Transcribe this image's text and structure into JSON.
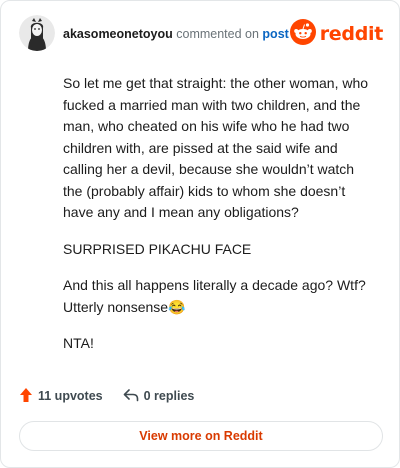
{
  "header": {
    "username": "akasomeonetoyou",
    "action": "commented on",
    "post_link": "post",
    "brand": "reddit"
  },
  "comment": {
    "paragraphs": [
      "So let me get that straight: the other woman, who fucked a married man with two children, and the man, who cheated on his wife who he had two children with, are pissed at the said wife and calling her a devil, because she wouldn’t watch the (probably affair) kids to whom she doesn’t have any and I mean any obligations?",
      "SURPRISED PIKACHU FACE",
      "And this all happens literally a decade ago? Wtf? Utterly nonsense😂",
      "NTA!"
    ]
  },
  "footer": {
    "upvotes": "11 upvotes",
    "replies": "0 replies",
    "view_more": "View more on Reddit"
  },
  "colors": {
    "brand": "#ff4500",
    "upvote": "#ff4500",
    "link": "#0a66c2",
    "view_more_text": "#d93a00"
  },
  "icons": {
    "avatar": "avatar",
    "brand": "reddit-snoo-icon",
    "upvote": "upvote-arrow-icon",
    "reply": "reply-arrow-icon"
  }
}
